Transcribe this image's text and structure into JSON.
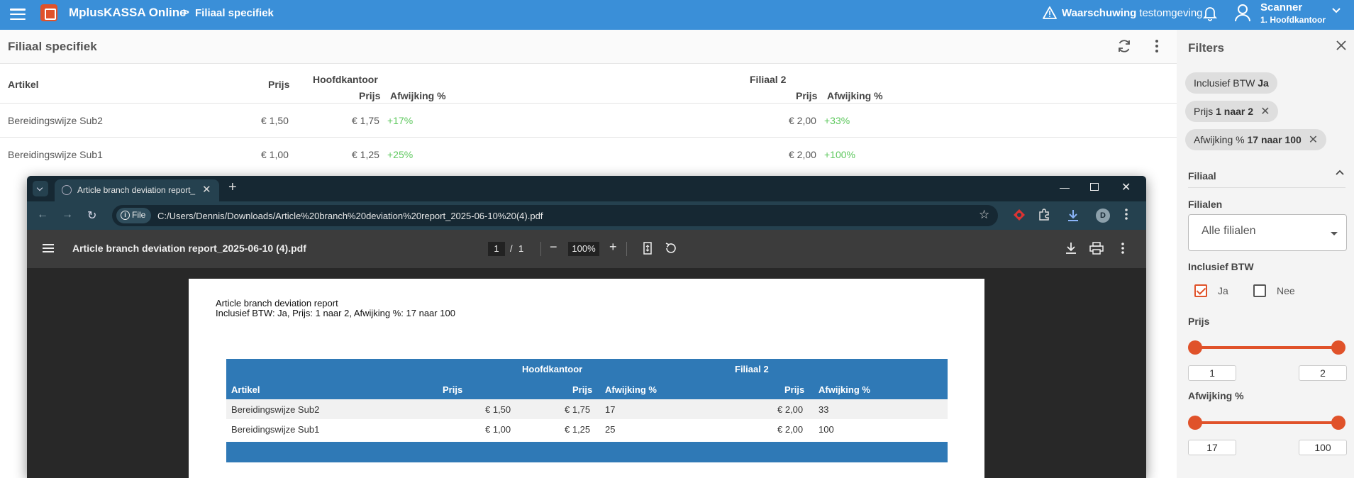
{
  "topbar": {
    "app_name": "MplusKASSA Online",
    "breadcrumb_sep": ">",
    "breadcrumb": "Filiaal specifiek",
    "warning_bold": "Waarschuwing",
    "warning_text": "testomgeving",
    "user_name": "Scanner",
    "user_branch": "1. Hoofdkantoor",
    "icons": [
      "menu-icon",
      "logo-icon",
      "warning-icon",
      "bell-icon",
      "user-icon",
      "chevron-down-icon"
    ]
  },
  "main": {
    "title": "Filiaal specifiek",
    "columns": {
      "artikel": "Artikel",
      "prijs": "Prijs",
      "branch1": "Hoofdkantoor",
      "branch1_prijs": "Prijs",
      "branch1_afwijking": "Afwijking %",
      "branch2": "Filiaal 2",
      "branch2_prijs": "Prijs",
      "branch2_afwijking": "Afwijking %"
    },
    "rows": [
      {
        "artikel": "Bereidingswijze Sub2",
        "prijs": "€ 1,50",
        "b1_prijs": "€ 1,75",
        "b1_afw": "+17%",
        "b2_prijs": "€ 2,00",
        "b2_afw": "+33%"
      },
      {
        "artikel": "Bereidingswijze Sub1",
        "prijs": "€ 1,00",
        "b1_prijs": "€ 1,25",
        "b1_afw": "+25%",
        "b2_prijs": "€ 2,00",
        "b2_afw": "+100%"
      }
    ]
  },
  "filters": {
    "title": "Filters",
    "chips": [
      {
        "label": "Inclusief BTW",
        "value": "Ja",
        "removable": false
      },
      {
        "label": "Prijs",
        "value": "1 naar 2",
        "removable": true
      },
      {
        "label": "Afwijking %",
        "value": "17 naar 100",
        "removable": true
      }
    ],
    "section": "Filiaal",
    "filialen_label": "Filialen",
    "filialen_value": "Alle filialen",
    "btw_label": "Inclusief BTW",
    "btw_ja": "Ja",
    "btw_nee": "Nee",
    "btw_ja_checked": true,
    "btw_nee_checked": false,
    "prijs_label": "Prijs",
    "prijs_min": "1",
    "prijs_max": "2",
    "afwijking_label": "Afwijking %",
    "afwijking_min": "17",
    "afwijking_max": "100"
  },
  "browser": {
    "tab_title": "Article branch deviation report_",
    "file_chip": "File",
    "url": "C:/Users/Dennis/Downloads/Article%20branch%20deviation%20report_2025-06-10%20(4).pdf",
    "avatar_letter": "D",
    "window_buttons": [
      "minimize-icon",
      "maximize-icon",
      "close-icon"
    ],
    "accent": "#1e3a4a"
  },
  "pdf_viewer": {
    "file_title": "Article branch deviation report_2025-06-10 (4).pdf",
    "page_current": "1",
    "page_sep": "/",
    "page_total": "1",
    "zoom": "100%",
    "zoom_minus": "−",
    "zoom_plus": "+"
  },
  "pdf_doc": {
    "title": "Article branch deviation report",
    "subtitle": "Inclusief BTW: Ja, Prijs: 1 naar 2, Afwijking %: 17 naar 100",
    "branch1": "Hoofdkantoor",
    "branch2": "Filiaal 2",
    "h_artikel": "Artikel",
    "h_prijs": "Prijs",
    "h_b1_prijs": "Prijs",
    "h_b1_afw": "Afwijking %",
    "h_b2_prijs": "Prijs",
    "h_b2_afw": "Afwijking %",
    "rows": [
      {
        "artikel": "Bereidingswijze Sub2",
        "prijs": "€ 1,50",
        "b1_prijs": "€ 1,75",
        "b1_afw": "17",
        "b2_prijs": "€ 2,00",
        "b2_afw": "33"
      },
      {
        "artikel": "Bereidingswijze Sub1",
        "prijs": "€ 1,00",
        "b1_prijs": "€ 1,25",
        "b1_afw": "25",
        "b2_prijs": "€ 2,00",
        "b2_afw": "100"
      }
    ]
  },
  "colors": {
    "topbar": "#3a8fd8",
    "accent_orange": "#e0522a",
    "positive": "#5ec85e",
    "pdf_table_header": "#2f79b6"
  }
}
